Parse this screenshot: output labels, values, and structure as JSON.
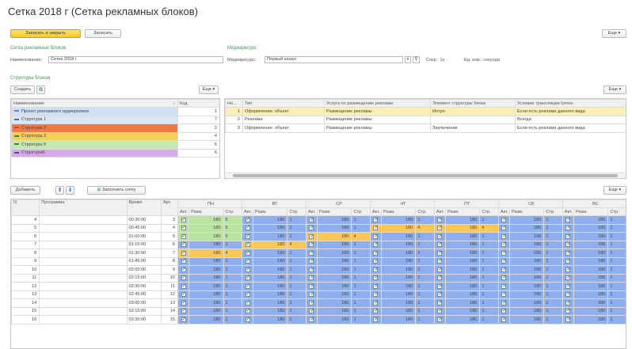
{
  "window": {
    "title": "Сетка 2018 г (Сетка рекламных блоков)"
  },
  "toolbar": {
    "save_close": "Записать и закрыть",
    "save": "Записать",
    "more": "Еще ▾"
  },
  "grid_section": {
    "label": "Сетка рекламных блоков",
    "name_label": "Наименование:",
    "name_value": "Сетка 2018 г"
  },
  "media_section": {
    "label": "Медиаресурс",
    "resource_label": "Медиаресурс:",
    "resource_value": "Первый канал",
    "sokr_label": "Сокр.: 1к",
    "unit_label": "Ед. изм.: секунда"
  },
  "structures": {
    "label": "Структуры блоков",
    "create": "Создать",
    "more": "Еще ▾",
    "col_name": "Наименование",
    "col_code": "Код",
    "rows": [
      {
        "name": "Проект рекламного аудиоролика",
        "code": "1",
        "color": "#cfe0f5",
        "dash": "#5c8bd6"
      },
      {
        "name": "Структура 1",
        "code": "7",
        "color": "#d9e6f7",
        "dash": "#3b6fb5"
      },
      {
        "name": "Структура 2",
        "code": "2",
        "color": "#f47a45",
        "dash": "#c94a1a"
      },
      {
        "name": "Структура 3",
        "code": "4",
        "color": "#f6cf58",
        "dash": "#2d8a3a"
      },
      {
        "name": "Структура 5",
        "code": "5",
        "color": "#c6e7b2",
        "dash": "#2d8a3a"
      },
      {
        "name": "Структура6",
        "code": "6",
        "color": "#d8a8ea",
        "dash": "#6a3a9a"
      }
    ]
  },
  "elements": {
    "more": "Еще ▾",
    "cols": [
      "Но...",
      "Тип",
      "Услуга по размещению рекламы",
      "Элемент структуры блока",
      "Условие трансляции блока"
    ],
    "rows": [
      [
        "1",
        "Оформление: объект",
        "Размещение рекламы",
        "Интро",
        "Если есть реклама данного вида"
      ],
      [
        "2",
        "Реклама",
        "Размещение рекламы",
        "",
        "Всегда"
      ],
      [
        "3",
        "Оформление: объект",
        "Размещение рекламы",
        "Заключение",
        "Если есть реклама данного вида"
      ]
    ]
  },
  "schedule": {
    "add": "Добавить",
    "fill": "Заполнить сетку",
    "more": "Еще ▾",
    "col_n": "N",
    "col_program": "Программа",
    "col_time": "Время",
    "col_art": "Арт.",
    "days": [
      "ПН",
      "ВТ",
      "СР",
      "ЧТ",
      "ПТ",
      "СБ",
      "ВС"
    ],
    "sub": [
      "Акт.",
      "Разм.",
      "Стр."
    ],
    "rows": [
      {
        "n": "4",
        "time": "00:30:00",
        "art": "3",
        "cells": [
          [
            "180",
            "5"
          ],
          [
            "180",
            "1"
          ],
          [
            "180",
            "1"
          ],
          [
            "180",
            "1"
          ],
          [
            "180",
            "1"
          ],
          [
            "180",
            "1"
          ],
          [
            "180",
            "1"
          ]
        ]
      },
      {
        "n": "5",
        "time": "00:45:00",
        "art": "4",
        "cells": [
          [
            "180",
            "5"
          ],
          [
            "180",
            "1"
          ],
          [
            "180",
            "1"
          ],
          [
            "180",
            "4"
          ],
          [
            "180",
            "4"
          ],
          [
            "180",
            "1"
          ],
          [
            "180",
            "1"
          ]
        ]
      },
      {
        "n": "6",
        "time": "01:00:00",
        "art": "5",
        "cells": [
          [
            "180",
            "5"
          ],
          [
            "180",
            "1"
          ],
          [
            "180",
            "4"
          ],
          [
            "180",
            "1"
          ],
          [
            "180",
            "1"
          ],
          [
            "180",
            "1"
          ],
          [
            "180",
            "1"
          ]
        ]
      },
      {
        "n": "7",
        "time": "01:15:00",
        "art": "6",
        "cells": [
          [
            "180",
            "1"
          ],
          [
            "180",
            "4"
          ],
          [
            "180",
            "1"
          ],
          [
            "180",
            "1"
          ],
          [
            "180",
            "1"
          ],
          [
            "180",
            "1"
          ],
          [
            "180",
            "1"
          ]
        ]
      },
      {
        "n": "8",
        "time": "01:30:00",
        "art": "7",
        "cells": [
          [
            "180",
            "4"
          ],
          [
            "180",
            "1"
          ],
          [
            "180",
            "1"
          ],
          [
            "180",
            "1"
          ],
          [
            "180",
            "1"
          ],
          [
            "180",
            "1"
          ],
          [
            "180",
            "1"
          ]
        ]
      },
      {
        "n": "9",
        "time": "01:45:00",
        "art": "8",
        "cells": [
          [
            "180",
            "1"
          ],
          [
            "180",
            "1"
          ],
          [
            "180",
            "1"
          ],
          [
            "180",
            "1"
          ],
          [
            "180",
            "1"
          ],
          [
            "180",
            "1"
          ],
          [
            "180",
            "1"
          ]
        ]
      },
      {
        "n": "10",
        "time": "02:00:00",
        "art": "9",
        "cells": [
          [
            "180",
            "1"
          ],
          [
            "180",
            "1"
          ],
          [
            "180",
            "1"
          ],
          [
            "180",
            "1"
          ],
          [
            "180",
            "1"
          ],
          [
            "180",
            "1"
          ],
          [
            "180",
            "1"
          ]
        ]
      },
      {
        "n": "11",
        "time": "02:15:00",
        "art": "10",
        "cells": [
          [
            "180",
            "1"
          ],
          [
            "180",
            "1"
          ],
          [
            "180",
            "1"
          ],
          [
            "180",
            "1"
          ],
          [
            "180",
            "1"
          ],
          [
            "180",
            "1"
          ],
          [
            "180",
            "1"
          ]
        ]
      },
      {
        "n": "12",
        "time": "02:30:00",
        "art": "11",
        "cells": [
          [
            "180",
            "1"
          ],
          [
            "180",
            "1"
          ],
          [
            "180",
            "1"
          ],
          [
            "180",
            "1"
          ],
          [
            "180",
            "1"
          ],
          [
            "180",
            "1"
          ],
          [
            "180",
            "1"
          ]
        ]
      },
      {
        "n": "13",
        "time": "02:45:00",
        "art": "12",
        "cells": [
          [
            "180",
            "1"
          ],
          [
            "180",
            "1"
          ],
          [
            "180",
            "1"
          ],
          [
            "180",
            "1"
          ],
          [
            "180",
            "1"
          ],
          [
            "180",
            "1"
          ],
          [
            "180",
            "1"
          ]
        ]
      },
      {
        "n": "14",
        "time": "03:00:00",
        "art": "13",
        "cells": [
          [
            "180",
            "1"
          ],
          [
            "180",
            "1"
          ],
          [
            "180",
            "1"
          ],
          [
            "180",
            "1"
          ],
          [
            "180",
            "1"
          ],
          [
            "180",
            "1"
          ],
          [
            "180",
            "1"
          ]
        ]
      },
      {
        "n": "15",
        "time": "03:15:00",
        "art": "14",
        "cells": [
          [
            "180",
            "1"
          ],
          [
            "180",
            "1"
          ],
          [
            "180",
            "1"
          ],
          [
            "180",
            "1"
          ],
          [
            "180",
            "1"
          ],
          [
            "180",
            "1"
          ],
          [
            "180",
            "1"
          ]
        ]
      },
      {
        "n": "16",
        "time": "03:30:00",
        "art": "15",
        "cells": [
          [
            "180",
            "1"
          ],
          [
            "180",
            "1"
          ],
          [
            "180",
            "1"
          ],
          [
            "180",
            "1"
          ],
          [
            "180",
            "1"
          ],
          [
            "180",
            "1"
          ],
          [
            "180",
            "1"
          ]
        ]
      }
    ],
    "colors": {
      "1": "#8eaef0",
      "4": "#f8c757",
      "5": "#b9e3a1"
    }
  }
}
